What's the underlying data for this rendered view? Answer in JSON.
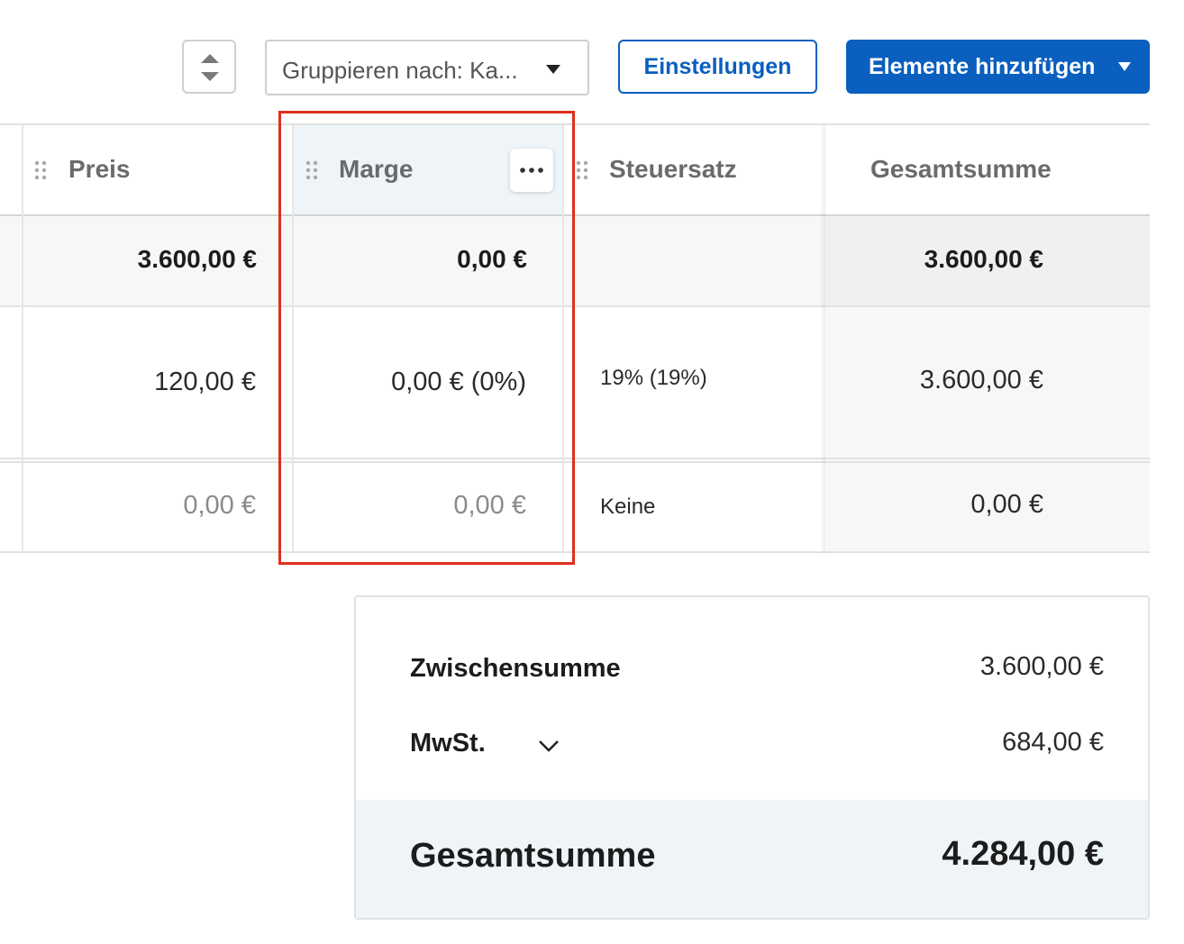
{
  "toolbar": {
    "group_select_value": "Gruppieren nach: Ka...",
    "settings_label": "Einstellungen",
    "add_items_label": "Elemente hinzufügen"
  },
  "table": {
    "columns": [
      "Preis",
      "Marge",
      "Steuersatz",
      "Gesamtsumme"
    ],
    "group_row": {
      "price": "3.600,00 €",
      "margin": "0,00 €",
      "tax": "",
      "total": "3.600,00 €"
    },
    "rows": [
      {
        "price": "120,00 €",
        "margin": "0,00 € (0%)",
        "tax": "19% (19%)",
        "total": "3.600,00 €"
      },
      {
        "price": "0,00 €",
        "margin": "0,00 €",
        "tax": "Keine",
        "total": "0,00 €"
      }
    ]
  },
  "summary": {
    "subtotal_label": "Zwischensumme",
    "subtotal_value": "3.600,00 €",
    "vat_label": "MwSt.",
    "vat_value": "684,00 €",
    "total_label": "Gesamtsumme",
    "total_value": "4.284,00 €"
  },
  "colors": {
    "primary_blue": "#0a5fbf",
    "highlight_red": "#e0301e",
    "total_band_bg": "#eef4f8"
  }
}
